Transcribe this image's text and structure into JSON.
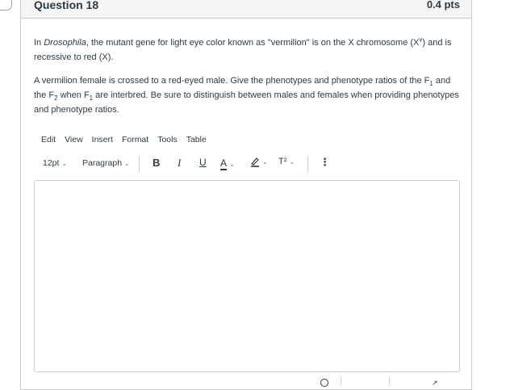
{
  "question": {
    "title": "Question 18",
    "points": "0.4 pts",
    "paragraph1": {
      "pre": "In ",
      "italic": "Drosophila",
      "mid": ", the mutant gene for light eye color known as \"vermilion\" is on the X chromosome (X",
      "sup": "v",
      "post": ") and is recessive to red (X)."
    },
    "paragraph2": {
      "a": "A vermilion female is crossed to a red-eyed male. Give the phenotypes and phenotype ratios of the F",
      "sub1": "1",
      "b": " and the F",
      "sub2": "2",
      "c": " when F",
      "sub3": "1",
      "d": " are interbred. Be sure to distinguish between males and females when providing phenotypes and phenotype ratios."
    }
  },
  "menubar": {
    "edit": "Edit",
    "view": "View",
    "insert": "Insert",
    "format": "Format",
    "tools": "Tools",
    "table": "Table"
  },
  "toolbar": {
    "font_size": "12pt",
    "block_format": "Paragraph",
    "bold": "B",
    "italic": "I",
    "underline": "U",
    "text_color": "A",
    "superscript": "T²",
    "more": "⋮"
  },
  "icons": {
    "chevron": "chevron-down-icon",
    "highlight": "highlighter-icon"
  },
  "editor": {
    "value": ""
  }
}
